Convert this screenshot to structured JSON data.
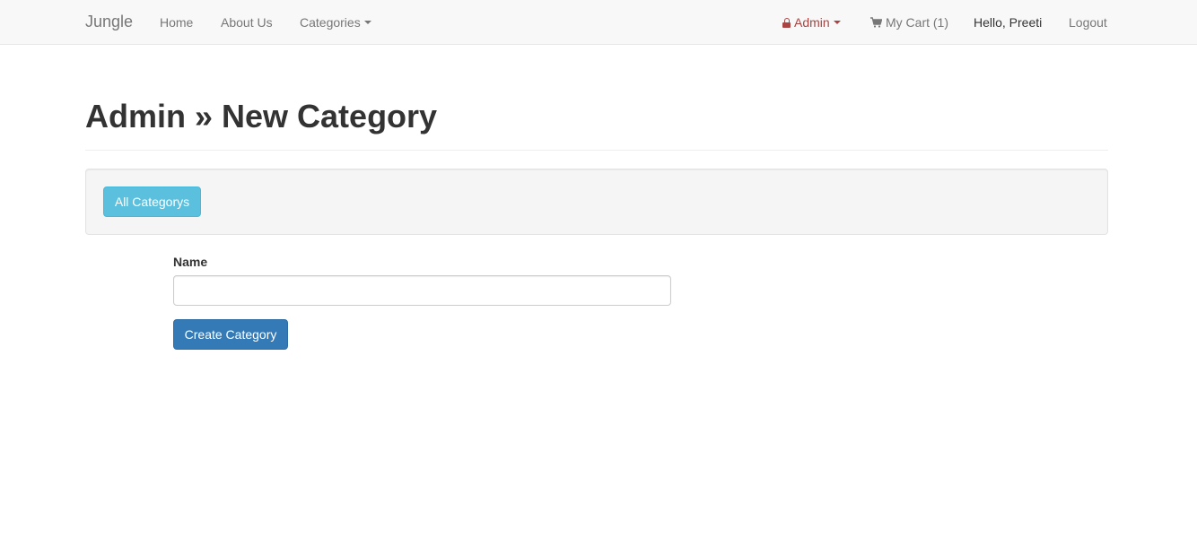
{
  "navbar": {
    "brand": "Jungle",
    "home": "Home",
    "about": "About Us",
    "categories": "Categories",
    "admin": "Admin",
    "cart": "My Cart (1)",
    "greeting": "Hello, Preeti",
    "logout": "Logout",
    "admin_color": "#a94442"
  },
  "header": {
    "title": "Admin » New Category"
  },
  "toolbar": {
    "all_categories_label": "All Categorys"
  },
  "form": {
    "name_label": "Name",
    "name_value": "",
    "submit_label": "Create Category"
  }
}
